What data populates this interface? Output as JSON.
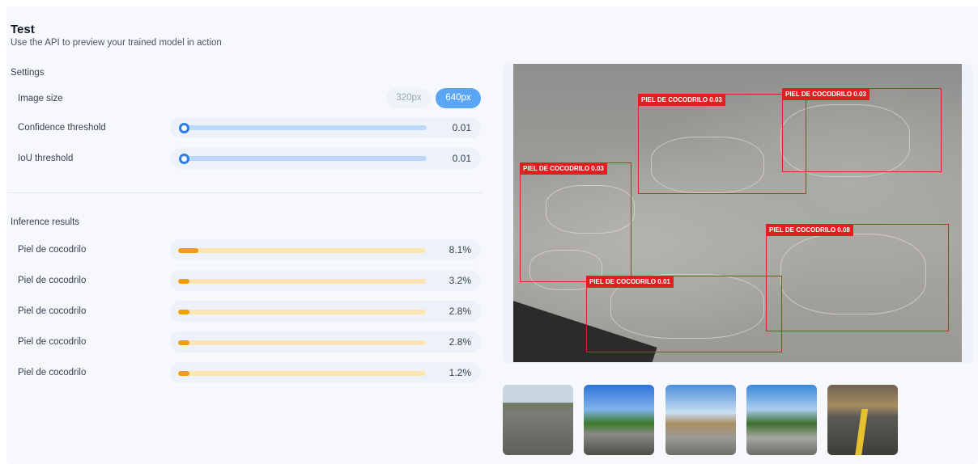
{
  "header": {
    "title": "Test",
    "subtitle": "Use the API to preview your trained model in action"
  },
  "settings": {
    "section_label": "Settings",
    "image_size": {
      "label": "Image size",
      "options": [
        "320px",
        "640px"
      ],
      "selected": "640px"
    },
    "confidence": {
      "label": "Confidence threshold",
      "value": "0.01"
    },
    "iou": {
      "label": "IoU threshold",
      "value": "0.01"
    }
  },
  "inference": {
    "section_label": "Inference results",
    "results": [
      {
        "label": "Piel de cocodrilo",
        "value": "8.1%",
        "fraction": 0.081
      },
      {
        "label": "Piel de cocodrilo",
        "value": "3.2%",
        "fraction": 0.032
      },
      {
        "label": "Piel de cocodrilo",
        "value": "2.8%",
        "fraction": 0.028
      },
      {
        "label": "Piel de cocodrilo",
        "value": "2.8%",
        "fraction": 0.028
      },
      {
        "label": "Piel de cocodrilo",
        "value": "1.2%",
        "fraction": 0.012
      }
    ]
  },
  "preview": {
    "detections": [
      {
        "label": "PIEL DE COCODRILO 0.03"
      },
      {
        "label": "PIEL DE COCODRILO 0.03"
      },
      {
        "label": "PIEL DE COCODRILO 0.03"
      },
      {
        "label": "PIEL DE COCODRILO 0.08"
      },
      {
        "label": "PIEL DE COCODRILO 0.01"
      }
    ]
  },
  "colors": {
    "accent": "#2b7de9",
    "selected_pill": "#5aa6f5",
    "bar_fill": "#f39c12",
    "bar_track": "#fde4b3",
    "detection_box": "#e02020"
  }
}
